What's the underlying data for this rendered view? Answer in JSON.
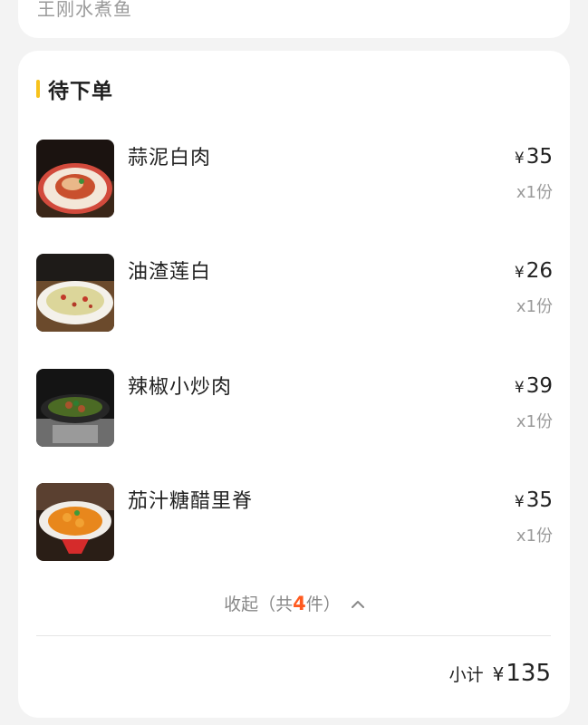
{
  "prev_card": {
    "text": "王刚水煮鱼"
  },
  "section": {
    "title": "待下单"
  },
  "items": [
    {
      "name": "蒜泥白肉",
      "currency": "¥",
      "price": "35",
      "qty": "x1份"
    },
    {
      "name": "油渣莲白",
      "currency": "¥",
      "price": "26",
      "qty": "x1份"
    },
    {
      "name": "辣椒小炒肉",
      "currency": "¥",
      "price": "39",
      "qty": "x1份"
    },
    {
      "name": "茄汁糖醋里脊",
      "currency": "¥",
      "price": "35",
      "qty": "x1份"
    }
  ],
  "collapse": {
    "prefix": "收起（共",
    "count": "4",
    "suffix": "件）"
  },
  "subtotal": {
    "label": "小计",
    "currency": "¥",
    "amount": "135"
  },
  "colors": {
    "accent_bar": "#f7c21c",
    "count_highlight": "#ff5a1f"
  }
}
